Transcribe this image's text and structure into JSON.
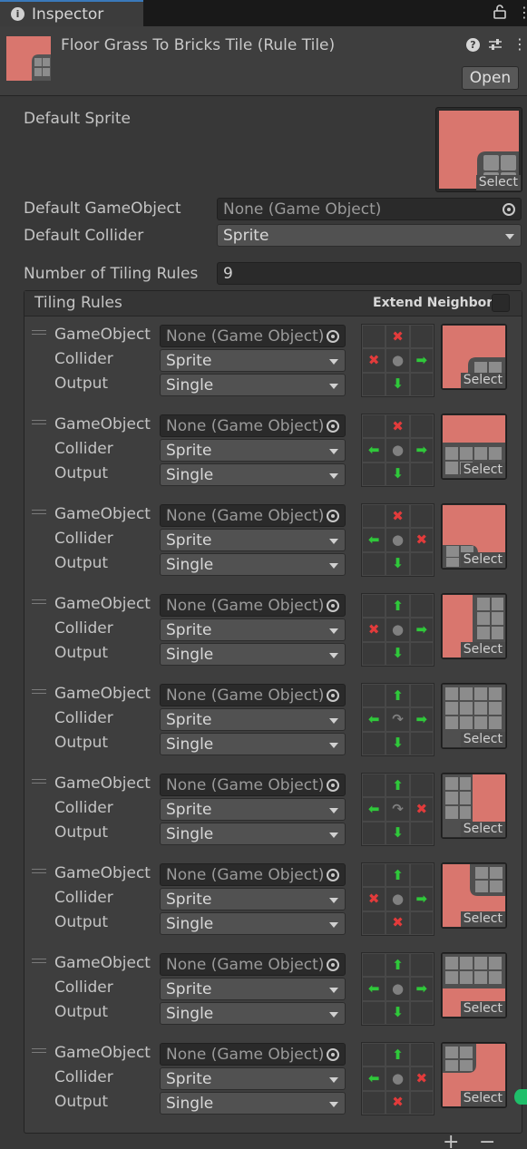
{
  "tab": {
    "label": "Inspector",
    "icon": "info-icon"
  },
  "header": {
    "title": "Floor Grass To Bricks Tile (Rule Tile)",
    "open_label": "Open",
    "help_symbol": "?"
  },
  "fields": {
    "default_sprite_label": "Default Sprite",
    "select_label": "Select",
    "default_gameobject_label": "Default GameObject",
    "default_gameobject_value": "None (Game Object)",
    "default_collider_label": "Default Collider",
    "default_collider_value": "Sprite",
    "num_rules_label": "Number of Tiling Rules",
    "num_rules_value": "9"
  },
  "rules_panel": {
    "title": "Tiling Rules",
    "extend_neighbor_label": "Extend Neighbor"
  },
  "rule_labels": {
    "gameobject": "GameObject",
    "collider": "Collider",
    "output": "Output",
    "gameobject_value": "None (Game Object)",
    "collider_value": "Sprite",
    "output_value": "Single",
    "select": "Select"
  },
  "rules": [
    {
      "grid": [
        "",
        "x",
        "",
        "x",
        "c",
        "right",
        "",
        "down",
        ""
      ],
      "thumb": "corner-top-left"
    },
    {
      "grid": [
        "",
        "x",
        "",
        "left",
        "c",
        "right",
        "",
        "down",
        ""
      ],
      "thumb": "edge-top"
    },
    {
      "grid": [
        "",
        "x",
        "",
        "left",
        "c",
        "x",
        "",
        "down",
        ""
      ],
      "thumb": "corner-top-right"
    },
    {
      "grid": [
        "",
        "up",
        "",
        "x",
        "c",
        "right",
        "",
        "down",
        ""
      ],
      "thumb": "edge-left"
    },
    {
      "grid": [
        "",
        "up",
        "",
        "left",
        "r",
        "right",
        "",
        "down",
        ""
      ],
      "thumb": "center"
    },
    {
      "grid": [
        "",
        "up",
        "",
        "left",
        "r",
        "x",
        "",
        "down",
        ""
      ],
      "thumb": "edge-right"
    },
    {
      "grid": [
        "",
        "up",
        "",
        "x",
        "c",
        "right",
        "",
        "x",
        ""
      ],
      "thumb": "corner-bottom-left"
    },
    {
      "grid": [
        "",
        "up",
        "",
        "left",
        "c",
        "right",
        "",
        "down",
        ""
      ],
      "thumb": "edge-bottom"
    },
    {
      "grid": [
        "",
        "up",
        "",
        "left",
        "c",
        "x",
        "",
        "x",
        ""
      ],
      "thumb": "corner-bottom-right"
    }
  ],
  "footer": {
    "add_label": "+",
    "remove_label": "−"
  },
  "colors": {
    "grass": "#d9766e",
    "brick": "#8a8a8a",
    "accent": "#3a79bb",
    "arrow_green": "#2fc83a",
    "cross_red": "#e23b3b"
  }
}
